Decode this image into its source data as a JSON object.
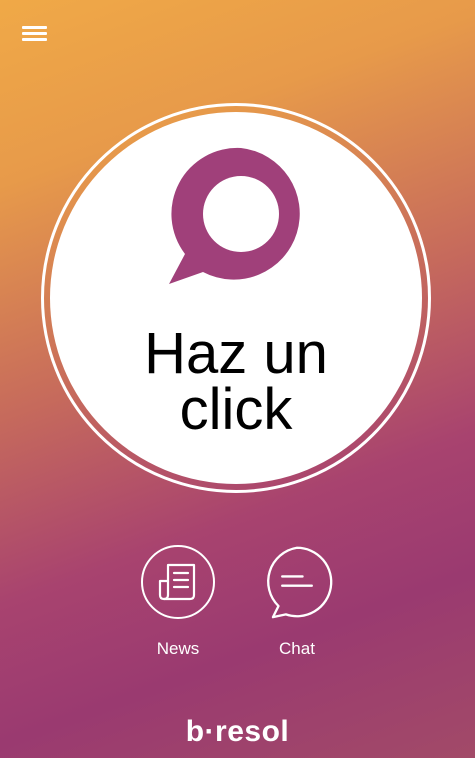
{
  "menu": {
    "icon": "hamburger-icon"
  },
  "hero": {
    "logo_icon": "speech-bubble-logo-icon",
    "line1": "Haz un",
    "line2": "click",
    "brand_color": "#a0407a"
  },
  "actions": [
    {
      "label": "News",
      "icon": "newspaper-icon"
    },
    {
      "label": "Chat",
      "icon": "chat-bubble-icon"
    }
  ],
  "brand": {
    "name": "b·resol"
  },
  "colors": {
    "gradient_top": "#f0a947",
    "gradient_bottom": "#9a3a70",
    "foreground": "#ffffff"
  }
}
